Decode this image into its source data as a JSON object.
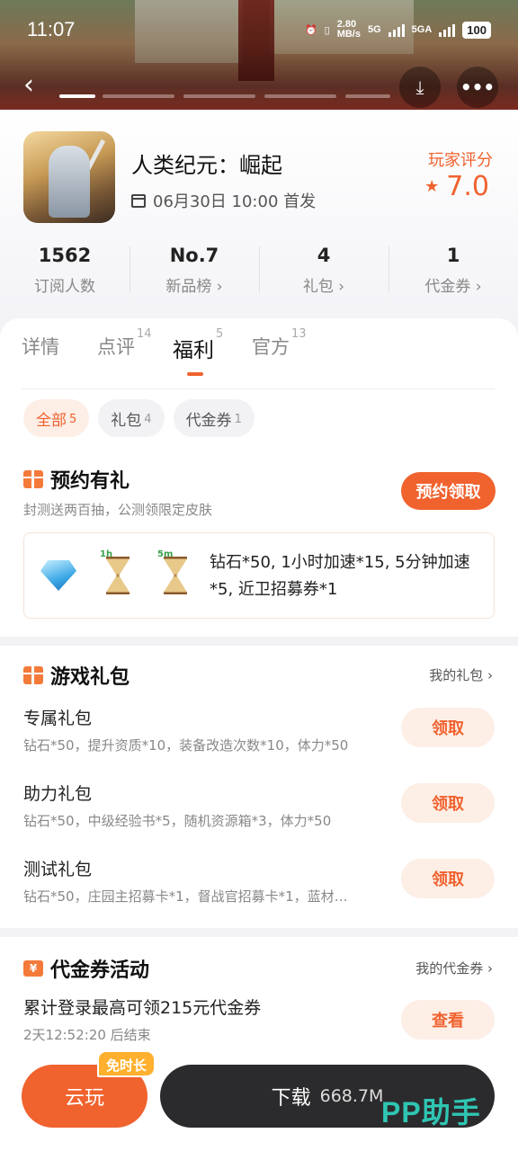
{
  "status_bar": {
    "time": "11:07",
    "net_speed_top": "2.80",
    "net_speed_unit": "MB/s",
    "net1": "5G",
    "net2": "5GA",
    "battery": "100"
  },
  "hero": {
    "icons": [
      "back-icon",
      "download-icon",
      "more-icon"
    ]
  },
  "game": {
    "title": "人类纪元：崛起",
    "release": "06月30日 10:00 首发",
    "score_label": "玩家评分",
    "score": "7.0"
  },
  "stats": [
    {
      "value": "1562",
      "label": "订阅人数"
    },
    {
      "value": "No.7",
      "label": "新品榜 ›"
    },
    {
      "value": "4",
      "label": "礼包 ›"
    },
    {
      "value": "1",
      "label": "代金券 ›"
    }
  ],
  "tabs": [
    {
      "label": "详情",
      "count": ""
    },
    {
      "label": "点评",
      "count": "14"
    },
    {
      "label": "福利",
      "count": "5"
    },
    {
      "label": "官方",
      "count": "13"
    }
  ],
  "filters": [
    {
      "label": "全部",
      "count": "5"
    },
    {
      "label": "礼包",
      "count": "4"
    },
    {
      "label": "代金券",
      "count": "1"
    }
  ],
  "reservation": {
    "title": "预约有礼",
    "subtitle": "封测送两百抽，公测领限定皮肤",
    "button": "预约领取",
    "icon_tags": [
      "1h",
      "5m"
    ],
    "rewards": "钻石*50, 1小时加速*15, 5分钟加速*5, 近卫招募券*1"
  },
  "gift_section": {
    "title": "游戏礼包",
    "link": "我的礼包 ›",
    "items": [
      {
        "name": "专属礼包",
        "desc": "钻石*50，提升资质*10，装备改造次数*10，体力*50",
        "button": "领取"
      },
      {
        "name": "助力礼包",
        "desc": "钻石*50，中级经验书*5，随机资源箱*3，体力*50",
        "button": "领取"
      },
      {
        "name": "测试礼包",
        "desc": "钻石*50，庄园主招募卡*1，督战官招募卡*1，蓝材…",
        "button": "领取"
      }
    ]
  },
  "voucher_section": {
    "title": "代金券活动",
    "icon_text": "¥",
    "link": "我的代金券 ›",
    "item_title": "累计登录最高可领215元代金券",
    "item_time": "2天12:52:20 后结束",
    "button": "查看"
  },
  "bottom": {
    "cloud_play": "云玩",
    "badge": "免时长",
    "download": "下载",
    "size": "668.7M",
    "watermark": "PP助手"
  },
  "colors": {
    "accent": "#f0622e",
    "accent_light": "#fdeee6",
    "dark_button": "#2b2b2d",
    "watermark": "#2fc5b3"
  }
}
